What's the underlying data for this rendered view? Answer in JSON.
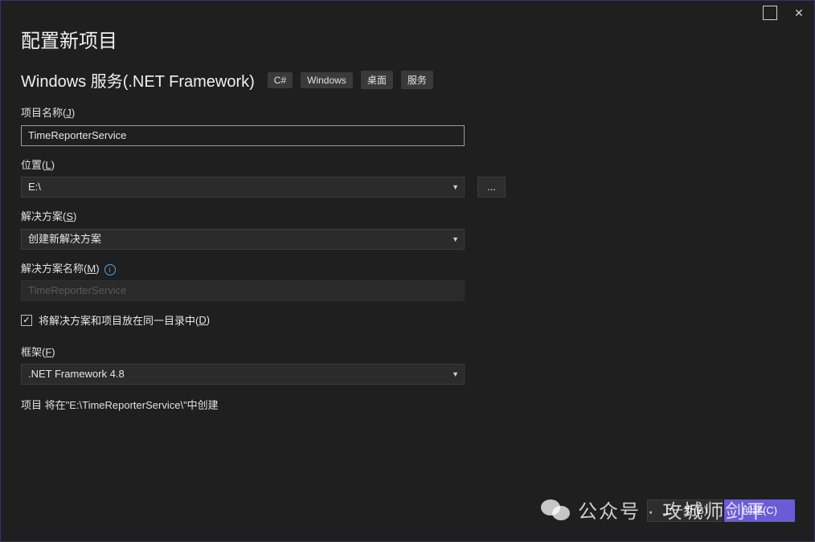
{
  "page_title": "配置新项目",
  "template": {
    "name": "Windows 服务(.NET Framework)",
    "tags": [
      "C#",
      "Windows",
      "桌面",
      "服务"
    ]
  },
  "project_name": {
    "label_text": "项目名称(",
    "label_key": "J",
    "label_end": ")",
    "value": "TimeReporterService"
  },
  "location": {
    "label_text": "位置(",
    "label_key": "L",
    "label_end": ")",
    "value": "E:\\",
    "browse_label": "..."
  },
  "solution": {
    "label_text": "解决方案(",
    "label_key": "S",
    "label_end": ")",
    "value": "创建新解决方案"
  },
  "solution_name": {
    "label_text": "解决方案名称(",
    "label_key": "M",
    "label_end": ")",
    "placeholder": "TimeReporterService",
    "info_glyph": "i"
  },
  "same_dir": {
    "label_text": "将解决方案和项目放在同一目录中(",
    "label_key": "D",
    "label_end": ")",
    "checked_glyph": "✓"
  },
  "framework": {
    "label_text": "框架(",
    "label_key": "F",
    "label_end": ")",
    "value": ".NET Framework 4.8"
  },
  "path_note": "项目 将在\"E:\\TimeReporterService\\\"中创建",
  "buttons": {
    "back": "上一步(B)",
    "create": "创建(C)"
  },
  "watermark": "公众号 · 攻城师剑平",
  "colors": {
    "background": "#1f1f1f",
    "accent": "#6b5bd6",
    "info": "#4ea6e8"
  }
}
